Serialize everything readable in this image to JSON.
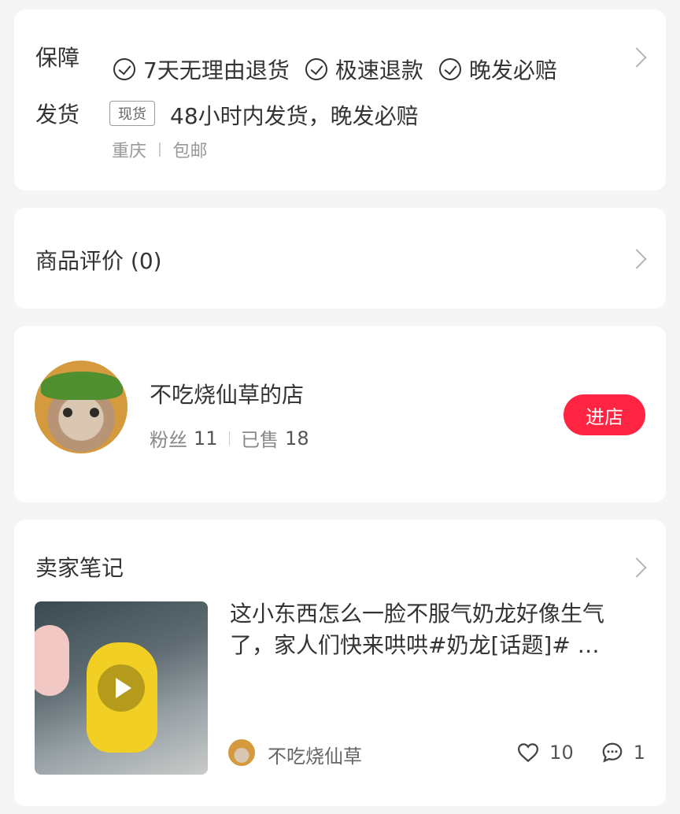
{
  "guarantee": {
    "label": "保障",
    "items": [
      "7天无理由退货",
      "极速退款",
      "晚发必赔"
    ]
  },
  "shipping": {
    "label": "发货",
    "tag": "现货",
    "text": "48小时内发货，晚发必赔",
    "origin": "重庆",
    "fee": "包邮"
  },
  "reviews": {
    "label": "商品评价 (0)"
  },
  "shop": {
    "name": "不吃烧仙草的店",
    "fans_label": "粉丝",
    "fans": "11",
    "sold_label": "已售",
    "sold": "18",
    "enter_label": "进店",
    "accent": "#ff2442"
  },
  "notes": {
    "section_title": "卖家笔记",
    "title": "这小东西怎么一脸不服气奶龙好像生气了，家人们快来哄哄#奶龙[话题]# …",
    "author": "不吃烧仙草",
    "likes": "10",
    "comments": "1"
  }
}
